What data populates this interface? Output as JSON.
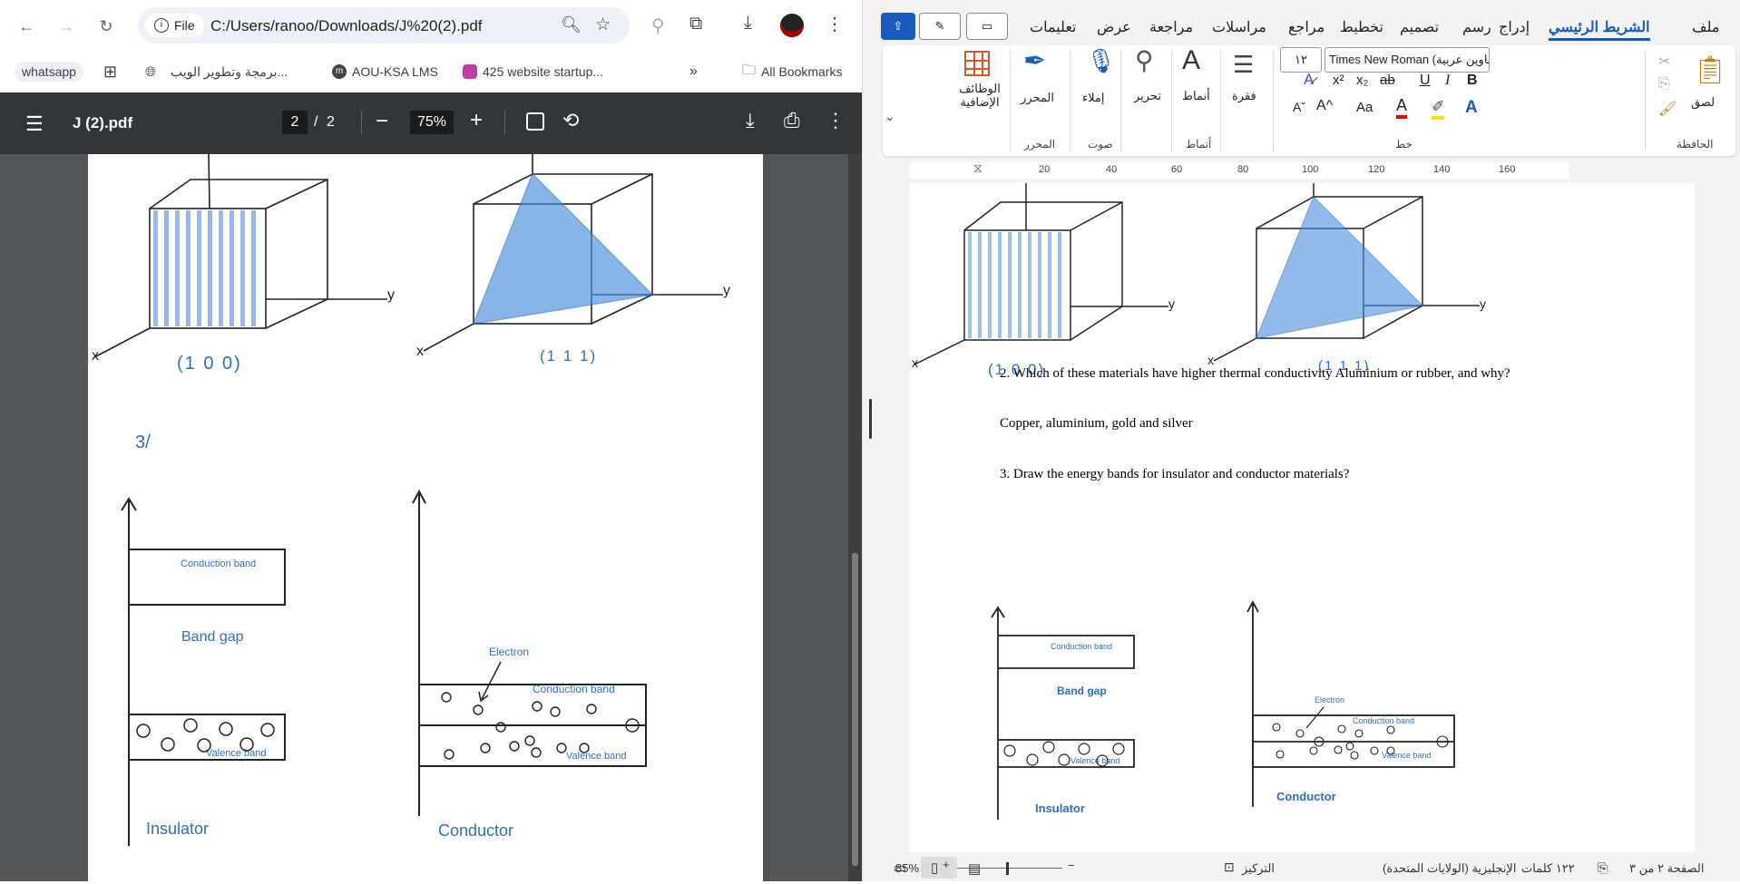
{
  "browser": {
    "site_chip": "File",
    "url": "C:/Users/ranoo/Downloads/J%20(2).pdf",
    "bookmarks": [
      {
        "label": "whatsapp"
      },
      {
        "label": "برمجة وتطوير الويب..."
      },
      {
        "label": "AOU-KSA LMS"
      },
      {
        "label": "425 website startup..."
      }
    ],
    "all_bookmarks": "All Bookmarks",
    "overflow": "»"
  },
  "pdf": {
    "filename": "J (2).pdf",
    "page_current": "2",
    "page_sep": "/",
    "page_total": "2",
    "zoom": "75%",
    "content": {
      "miller_left": "(1 0 0)",
      "miller_right": "(1 1 1)",
      "axis_x": "x",
      "axis_y": "y",
      "question_no": "3/",
      "conduction_band": "Conduction band",
      "band_gap": "Band gap",
      "valence_band": "Valence band",
      "electron": "Electron",
      "insulator": "Insulator",
      "conductor": "Conductor"
    }
  },
  "word": {
    "tabs": [
      "ملف",
      "الشريط الرئيسي",
      "إدراج",
      "رسم",
      "تصميم",
      "تخطيط",
      "مراجع",
      "مراسلات",
      "مراجعة",
      "عرض",
      "تعليمات"
    ],
    "active_tab": "الشريط الرئيسي",
    "ribbon": {
      "paste": "لصق",
      "clipboard": "الحافظة",
      "font_name": "Times New Roman (عناوين عربية)",
      "font_size": "١٢",
      "font_group": "خط",
      "paragraph": "فقرة",
      "styles": "أنماط",
      "editing": "تحرير",
      "dictate": "إملاء",
      "voice": "صوت",
      "editor": "المحرر",
      "addins": "الوظائف الإضافية",
      "bold": "B",
      "italic": "I",
      "underline": "U",
      "strike": "ab",
      "subscript": "x₂",
      "superscript": "x²",
      "change_case": "Aa"
    },
    "ruler_numbers": [
      "20",
      "40",
      "60",
      "80",
      "100",
      "120",
      "140",
      "160"
    ],
    "doc": {
      "q2": "2. Which of these materials have higher thermal conductivity Aluminium or rubber, and why?",
      "answer2": "Copper, aluminium, gold and silver",
      "q3": "3. Draw the energy bands for insulator and conductor materials?"
    },
    "status": {
      "page": "الصفحة ٢ من ٣",
      "words": "١٢٢ كلمات",
      "language": "الإنجليزية (الولايات المتحدة)",
      "focus": "التركيز",
      "zoom": "85%"
    }
  },
  "colors": {
    "pdf_toolbar": "#323639",
    "pdf_bg": "#525659",
    "word_accent": "#185abd",
    "drawing_blue": "#4a8fdc"
  }
}
